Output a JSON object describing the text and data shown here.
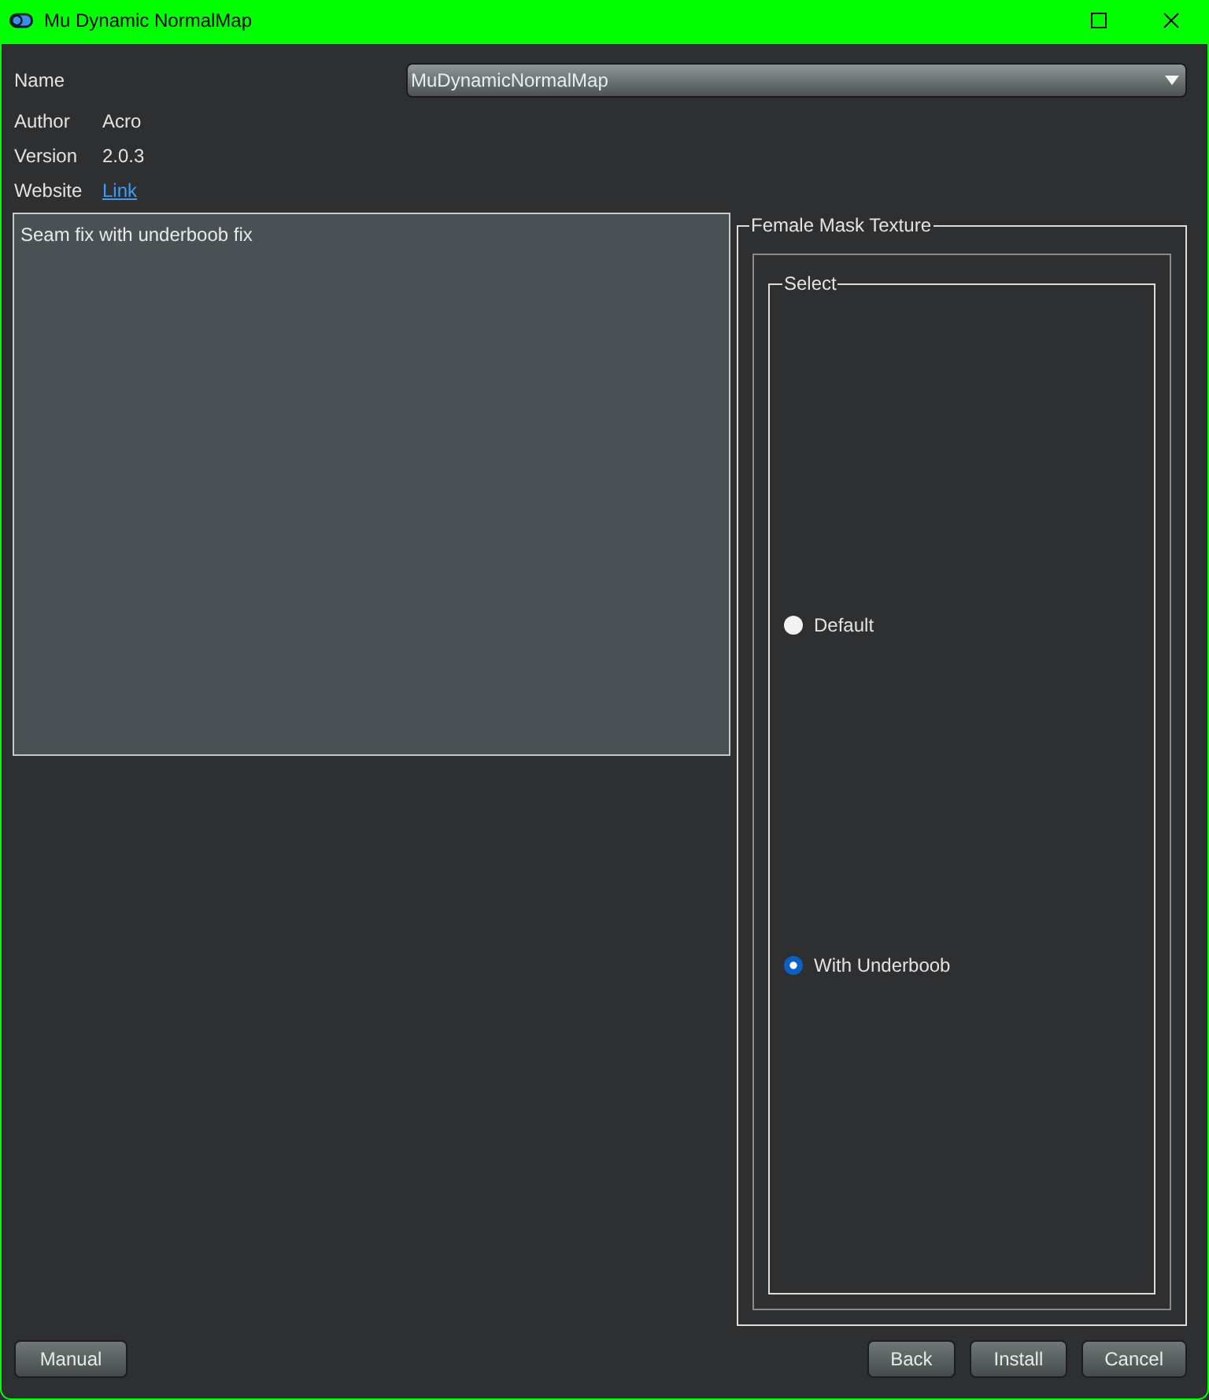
{
  "window": {
    "title": "Mu Dynamic NormalMap"
  },
  "info": [
    {
      "kind": "combo",
      "label": "Name",
      "value": "MuDynamicNormalMap"
    },
    {
      "kind": "text",
      "label": "Author",
      "value": "Acro"
    },
    {
      "kind": "text",
      "label": "Version",
      "value": "2.0.3"
    },
    {
      "kind": "link",
      "label": "Website",
      "value": "Link"
    }
  ],
  "description": "Seam fix with underboob fix",
  "group": {
    "title": "Female Mask Texture",
    "select": {
      "title": "Select",
      "options": [
        {
          "label": "Default",
          "selected": false
        },
        {
          "label": "With Underboob",
          "selected": true
        }
      ]
    }
  },
  "buttons": {
    "left": [
      "Manual"
    ],
    "right": [
      "Back",
      "Install",
      "Cancel"
    ]
  }
}
